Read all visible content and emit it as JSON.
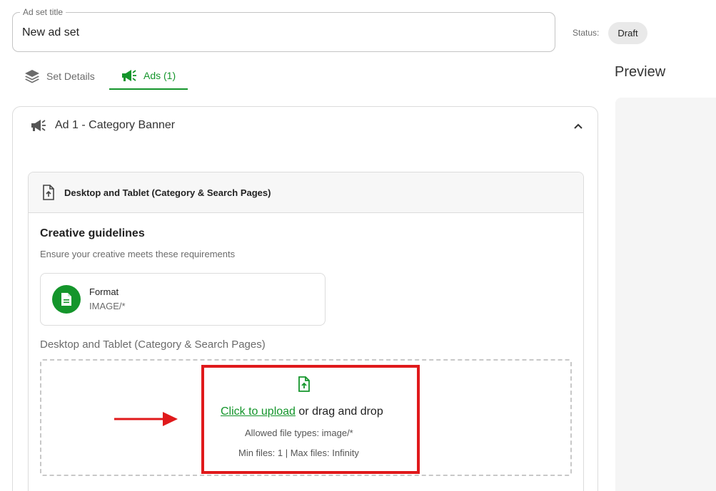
{
  "ad_set": {
    "title_label": "Ad set title",
    "title_value": "New ad set",
    "status_label": "Status:",
    "status_value": "Draft"
  },
  "tabs": [
    {
      "label": "Set Details",
      "icon": "layers-icon",
      "active": false
    },
    {
      "label": "Ads (1)",
      "icon": "megaphone-icon",
      "active": true
    }
  ],
  "preview": {
    "title": "Preview"
  },
  "ad": {
    "title": "Ad 1 - Category Banner",
    "icon": "megaphone-icon",
    "expanded": true
  },
  "placement": {
    "title": "Desktop and Tablet (Category & Search Pages)",
    "icon": "file-upload-icon",
    "guidelines_title": "Creative guidelines",
    "guidelines_subtitle": "Ensure your creative meets these requirements",
    "format": {
      "label": "Format",
      "value": "IMAGE/*",
      "icon": "document-icon"
    },
    "upload_label": "Desktop and Tablet (Category & Search Pages)",
    "dropzone": {
      "link_text": "Click to upload",
      "rest_text": "or drag and drop",
      "allowed_types": "Allowed file types: image/*",
      "limits": "Min files: 1 | Max files: Infinity"
    }
  },
  "colors": {
    "accent_green": "#14952b",
    "annotation_red": "#e0191b"
  }
}
